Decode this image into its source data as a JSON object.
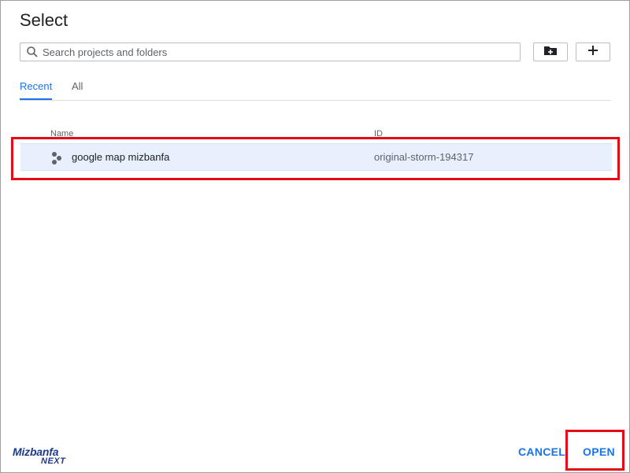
{
  "dialog": {
    "title": "Select"
  },
  "search": {
    "placeholder": "Search projects and folders",
    "icon": "search-icon"
  },
  "toolbar": {
    "new_folder_icon": "new-folder-icon",
    "add_icon": "plus-icon"
  },
  "tabs": [
    {
      "label": "Recent",
      "active": true
    },
    {
      "label": "All",
      "active": false
    }
  ],
  "table": {
    "columns": [
      "Name",
      "ID"
    ],
    "rows": [
      {
        "name": "google map mizbanfa",
        "id": "original-storm-194317",
        "selected": true,
        "icon": "project-icon"
      }
    ]
  },
  "footer": {
    "cancel_label": "CANCEL",
    "open_label": "OPEN"
  },
  "watermark": {
    "brand": "Mizbanfa",
    "sub": "NEXT"
  },
  "colors": {
    "accent": "#1a73e8",
    "selected_row": "#e8f0fe",
    "annotation": "#e30b17"
  }
}
